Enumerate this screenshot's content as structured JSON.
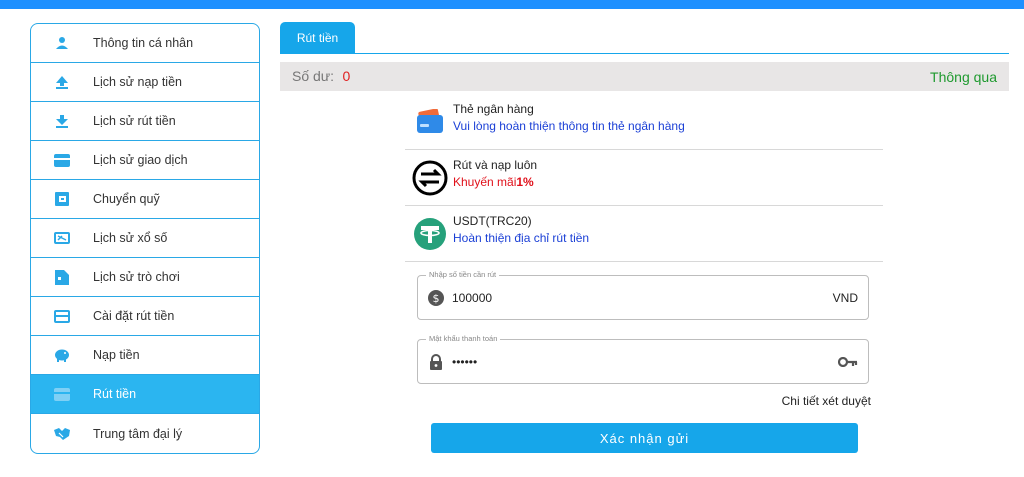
{
  "sidebar": {
    "items": [
      {
        "label": "Thông tin cá nhân",
        "icon": "user-icon"
      },
      {
        "label": "Lịch sử nạp tiền",
        "icon": "upload-arrow-icon"
      },
      {
        "label": "Lịch sử rút tiền",
        "icon": "download-arrow-icon"
      },
      {
        "label": "Lịch sử giao dịch",
        "icon": "card-icon"
      },
      {
        "label": "Chuyển quỹ",
        "icon": "transfer-box-icon"
      },
      {
        "label": "Lịch sử xổ số",
        "icon": "lottery-icon"
      },
      {
        "label": "Lịch sử trò chơi",
        "icon": "game-doc-icon"
      },
      {
        "label": "Cài đặt rút tiền",
        "icon": "bank-card-icon"
      },
      {
        "label": "Nạp tiền",
        "icon": "piggy-bank-icon"
      },
      {
        "label": "Rút tiền",
        "icon": "wallet-card-icon",
        "active": true
      },
      {
        "label": "Trung tâm đại lý",
        "icon": "agent-handshake-icon"
      }
    ]
  },
  "tab": {
    "label": "Rút tiền"
  },
  "balance": {
    "label": "Số dư:",
    "value": "0",
    "status": "Thông qua"
  },
  "methods": [
    {
      "title": "Thẻ ngân hàng",
      "subtitle": "Vui lòng hoàn thiện thông tin thẻ ngân hàng",
      "icon": "bank-card-icon"
    },
    {
      "title": "Rút và nạp luôn",
      "subtitle_prefix": "Khuyến mãi",
      "subtitle_bold": "1%",
      "icon": "exchange-icon"
    },
    {
      "title": "USDT(TRC20)",
      "subtitle": "Hoàn thiện địa chỉ rút tiền",
      "icon": "tether-icon"
    }
  ],
  "amount_field": {
    "legend": "Nhập số tiền cần rút",
    "value": "100000",
    "suffix": "VND"
  },
  "password_field": {
    "legend": "Mật khẩu thanh toán",
    "value": "••••••"
  },
  "detail_link": "Chi tiết xét duyệt",
  "submit_label": "Xác nhận gửi",
  "colors": {
    "accent": "#16a6ea",
    "active_item": "#2bb5f0",
    "status_green": "#1f9a2f",
    "balance_red": "#e02020"
  }
}
